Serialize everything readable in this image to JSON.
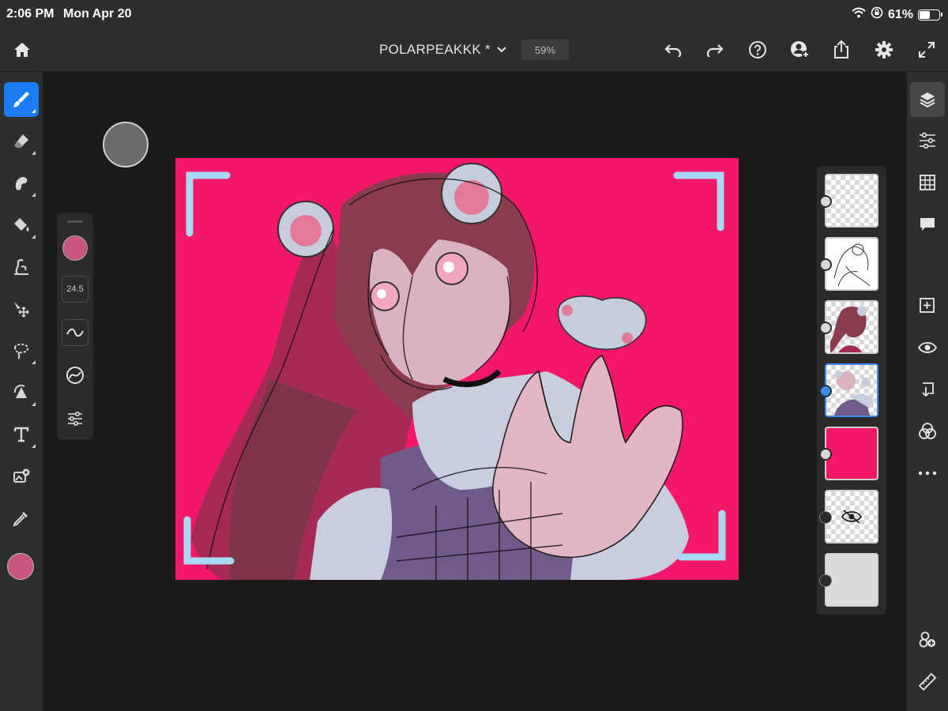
{
  "status": {
    "time": "2:06 PM",
    "date": "Mon Apr 20",
    "battery_label": "61%",
    "battery_level": 0.61
  },
  "header": {
    "title": "POLARPEAKKK *",
    "zoom": "59%"
  },
  "brush_panel": {
    "size": "24.5"
  },
  "colors": {
    "accent": "#1a7cf4",
    "brush": "#c8557f",
    "canvas_bg": "#f4176a",
    "ui_bg": "#2e2e2e",
    "workspace": "#1b1b1b"
  },
  "left_tools": [
    "brush-icon",
    "eraser-icon",
    "smudge-icon",
    "fill-icon",
    "liquify-icon",
    "move-icon",
    "lasso-icon",
    "transform-icon",
    "text-icon",
    "place-image-icon",
    "eyedropper-icon"
  ],
  "right_tools": [
    "layers-icon",
    "adjustments-icon",
    "grid-icon",
    "comments-icon",
    "add-layer-icon",
    "visibility-icon",
    "merge-down-icon",
    "blend-mode-icon",
    "more-icon",
    "effects-icon",
    "ruler-icon"
  ],
  "layers": [
    {
      "kind": "empty",
      "selected": false,
      "visible": true
    },
    {
      "kind": "lineart",
      "selected": false,
      "visible": true
    },
    {
      "kind": "hair",
      "selected": false,
      "visible": true
    },
    {
      "kind": "color",
      "selected": true,
      "visible": true
    },
    {
      "kind": "background-pink",
      "selected": false,
      "visible": true
    },
    {
      "kind": "hidden",
      "selected": false,
      "visible": false
    },
    {
      "kind": "paper",
      "selected": false,
      "visible": true
    }
  ]
}
